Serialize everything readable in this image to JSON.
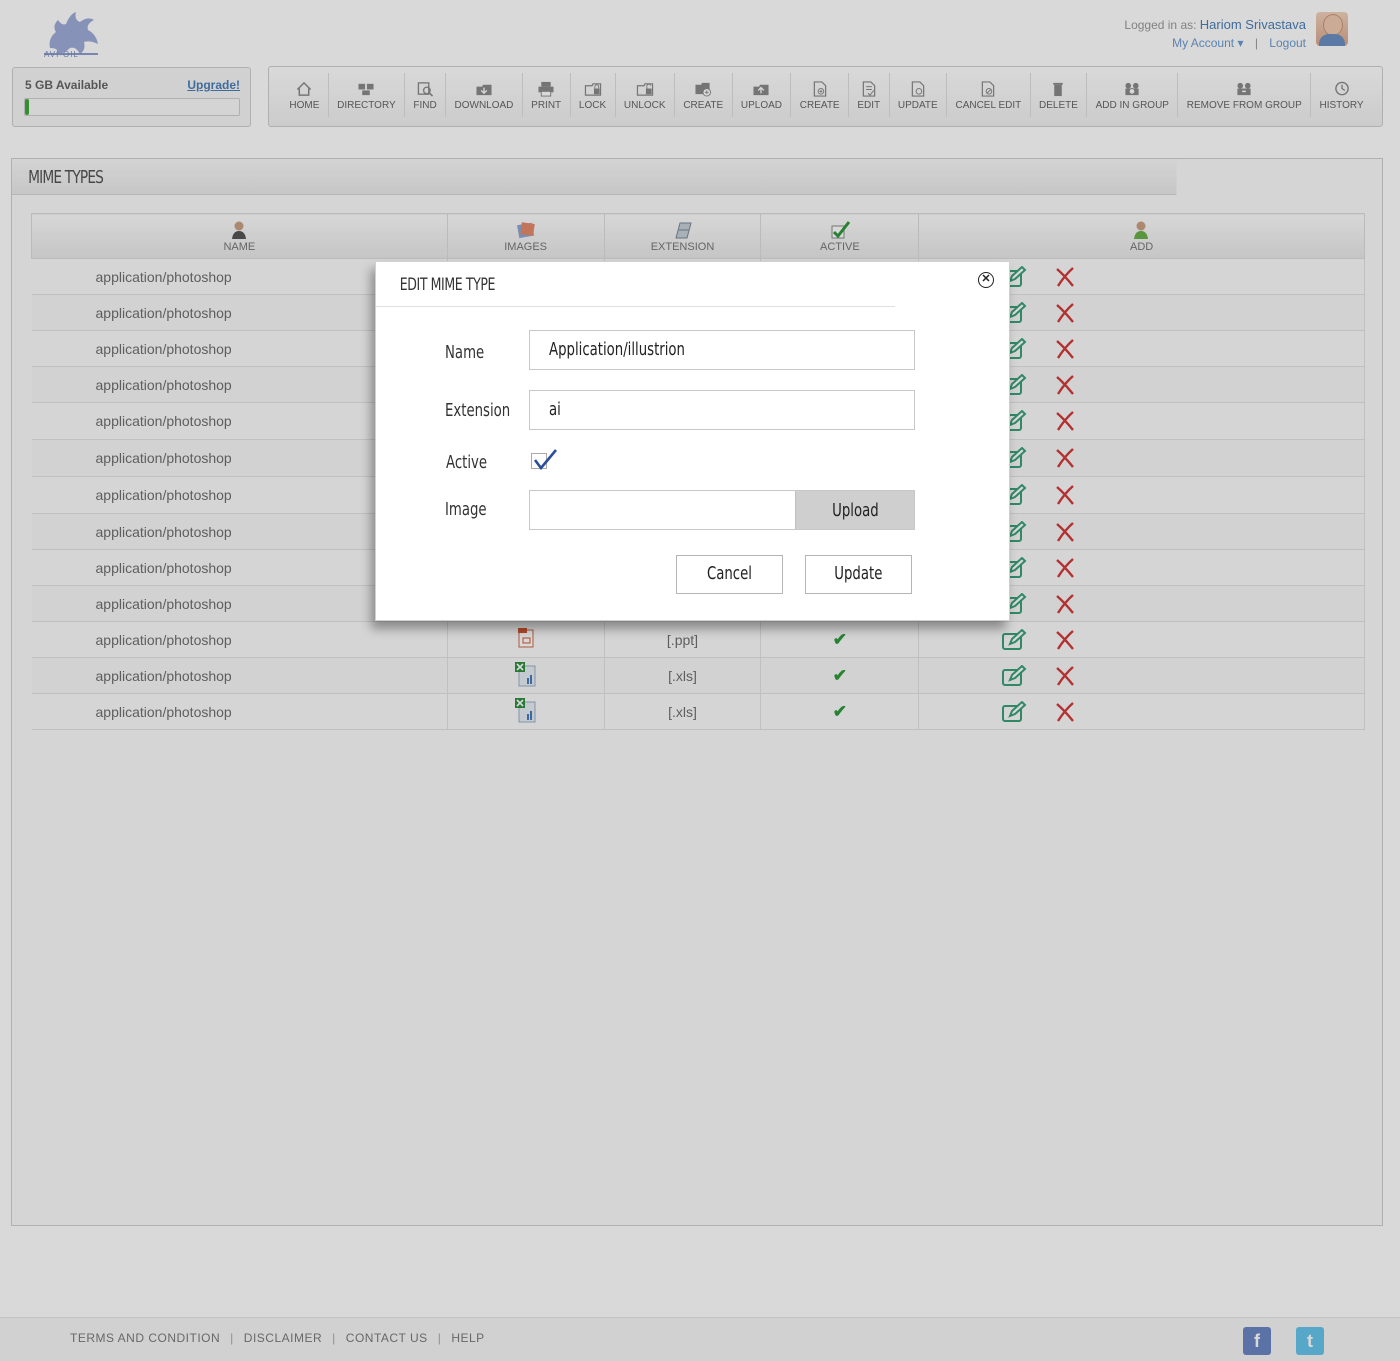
{
  "brand": {
    "logo_text": "AVI-OIL"
  },
  "user": {
    "logged_in_label": "Logged in as:",
    "name": "Hariom Srivastava",
    "my_account": "My Account",
    "logout": "Logout"
  },
  "storage": {
    "available": "5 GB Available",
    "upgrade": "Upgrade!",
    "used_fraction": 0.02
  },
  "toolbar": [
    {
      "label": "HOME",
      "icon": "home-icon"
    },
    {
      "label": "DIRECTORY",
      "icon": "directory-icon"
    },
    {
      "label": "FIND",
      "icon": "find-icon"
    },
    {
      "label": "DOWNLOAD",
      "icon": "download-icon"
    },
    {
      "label": "PRINT",
      "icon": "print-icon"
    },
    {
      "label": "LOCK",
      "icon": "lock-icon"
    },
    {
      "label": "UNLOCK",
      "icon": "unlock-icon"
    },
    {
      "label": "CREATE",
      "icon": "create-folder-icon"
    },
    {
      "label": "UPLOAD",
      "icon": "upload-icon"
    },
    {
      "label": "CREATE",
      "icon": "create-file-icon"
    },
    {
      "label": "EDIT",
      "icon": "edit-icon"
    },
    {
      "label": "UPDATE",
      "icon": "update-icon"
    },
    {
      "label": "CANCEL EDIT",
      "icon": "cancel-edit-icon"
    },
    {
      "label": "DELETE",
      "icon": "delete-icon"
    },
    {
      "label": "ADD IN GROUP",
      "icon": "add-group-icon"
    },
    {
      "label": "REMOVE FROM GROUP",
      "icon": "remove-group-icon"
    },
    {
      "label": "HISTORY",
      "icon": "history-icon"
    }
  ],
  "panel": {
    "title": "MIME TYPES"
  },
  "table": {
    "headers": {
      "name": "NAME",
      "images": "IMAGES",
      "extension": "EXTENSION",
      "active": "ACTIVE",
      "add": "ADD"
    },
    "rows": [
      {
        "name": "application/photoshop",
        "extension": "",
        "active": true,
        "file_icon": ""
      },
      {
        "name": "application/photoshop",
        "extension": "",
        "active": true,
        "file_icon": ""
      },
      {
        "name": "application/photoshop",
        "extension": "",
        "active": true,
        "file_icon": ""
      },
      {
        "name": "application/photoshop",
        "extension": "",
        "active": true,
        "file_icon": ""
      },
      {
        "name": "application/photoshop",
        "extension": "",
        "active": true,
        "file_icon": ""
      },
      {
        "name": "application/photoshop",
        "extension": "",
        "active": true,
        "file_icon": ""
      },
      {
        "name": "application/photoshop",
        "extension": "",
        "active": true,
        "file_icon": ""
      },
      {
        "name": "application/photoshop",
        "extension": "",
        "active": true,
        "file_icon": ""
      },
      {
        "name": "application/photoshop",
        "extension": "",
        "active": true,
        "file_icon": ""
      },
      {
        "name": "application/photoshop",
        "extension": "",
        "active": true,
        "file_icon": ""
      },
      {
        "name": "application/photoshop",
        "extension": "[.ppt]",
        "active": true,
        "file_icon": "ppt-file-icon"
      },
      {
        "name": "application/photoshop",
        "extension": "[.xls]",
        "active": true,
        "file_icon": "xls-file-icon"
      },
      {
        "name": "application/photoshop",
        "extension": "[.xls]",
        "active": true,
        "file_icon": "xls-file-icon"
      }
    ]
  },
  "modal": {
    "title": "EDIT MIME TYPE",
    "name_label": "Name",
    "name_value": "Application/illustrion",
    "extension_label": "Extension",
    "extension_value": "ai",
    "active_label": "Active",
    "active_checked": true,
    "image_label": "Image",
    "upload_label": "Upload",
    "cancel_label": "Cancel",
    "update_label": "Update"
  },
  "footer": {
    "links": [
      "TERMS AND CONDITION",
      "DISCLAIMER",
      "CONTACT US",
      "HELP"
    ],
    "social": [
      "f",
      "t"
    ]
  },
  "colors": {
    "accent": "#4a7fb9",
    "check": "#2e9b3b",
    "delete": "#d23a3a",
    "edit": "#3aa07a"
  }
}
